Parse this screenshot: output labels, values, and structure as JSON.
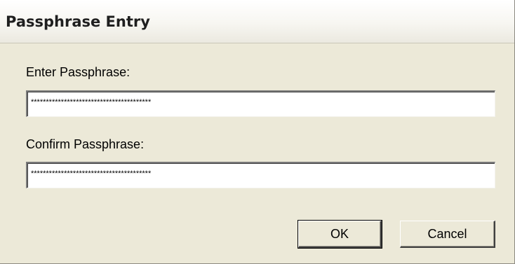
{
  "window": {
    "title": "Passphrase Entry"
  },
  "form": {
    "passphrase_label": "Enter Passphrase:",
    "passphrase_value": "****************************************",
    "confirm_label": "Confirm Passphrase:",
    "confirm_value": "****************************************"
  },
  "buttons": {
    "ok_label": "OK",
    "cancel_label": "Cancel"
  },
  "colors": {
    "dialog_background": "#ece9d8",
    "field_background": "#ffffff"
  }
}
